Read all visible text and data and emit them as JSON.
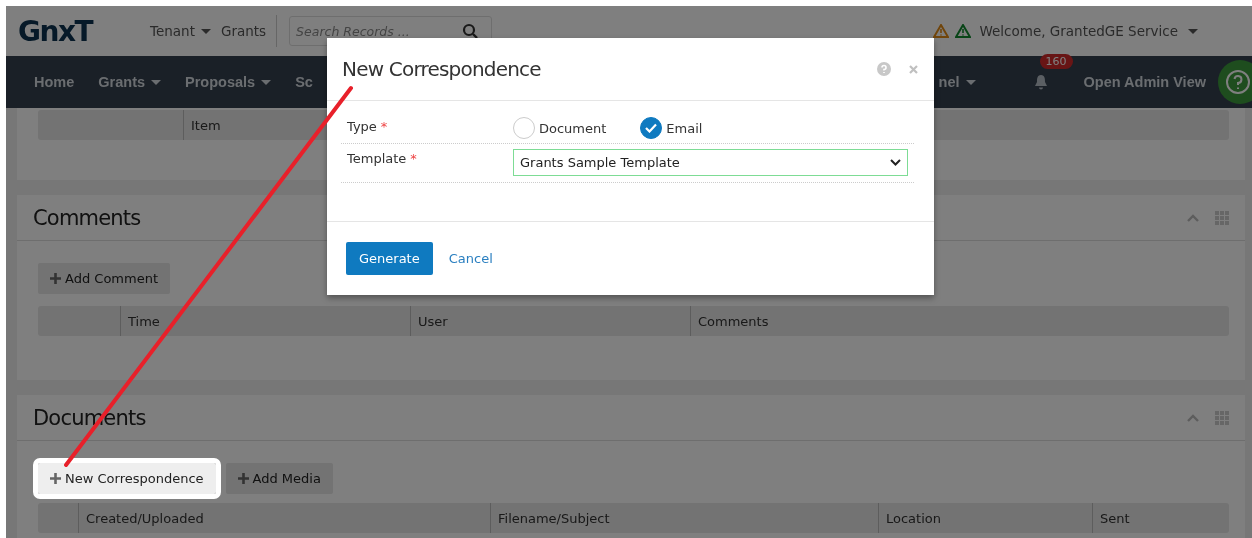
{
  "header": {
    "logo": "GnxT",
    "tenant_menu": "Tenant",
    "app_link": "Grants",
    "search": {
      "placeholder": "Search Records ..."
    },
    "welcome": "Welcome, GrantedGE Service"
  },
  "nav": {
    "left_items": [
      {
        "label": "Home",
        "dropdown": false
      },
      {
        "label": "Grants",
        "dropdown": true
      },
      {
        "label": "Proposals",
        "dropdown": true
      },
      {
        "label": "Sc",
        "dropdown": false
      }
    ],
    "right_items": [
      {
        "label": "nel",
        "dropdown": true
      }
    ],
    "notifications": {
      "count": "160"
    },
    "admin_link": "Open Admin View"
  },
  "panels": [
    {
      "columns": [
        "Item"
      ]
    },
    {
      "title": "Comments",
      "buttons": [
        {
          "label": "Add Comment",
          "highlighted": false
        }
      ],
      "columns": [
        "Time",
        "User",
        "Comments"
      ]
    },
    {
      "title": "Documents",
      "buttons": [
        {
          "label": "New Correspondence",
          "highlighted": true
        },
        {
          "label": "Add Media",
          "highlighted": false
        }
      ],
      "columns": [
        "Created/Uploaded",
        "Filename/Subject",
        "Location",
        "Sent"
      ]
    }
  ],
  "modal": {
    "title": "New Correspondence",
    "fields": [
      {
        "kind": "radio",
        "label": "Type",
        "required_mark": "*",
        "options": [
          {
            "label": "Document",
            "selected": false
          },
          {
            "label": "Email",
            "selected": true
          }
        ]
      },
      {
        "kind": "select",
        "label": "Template",
        "required_mark": "*",
        "value": "Grants Sample Template"
      }
    ],
    "buttons": [
      {
        "kind": "primary",
        "label": "Generate"
      },
      {
        "kind": "link",
        "label": "Cancel"
      }
    ]
  }
}
